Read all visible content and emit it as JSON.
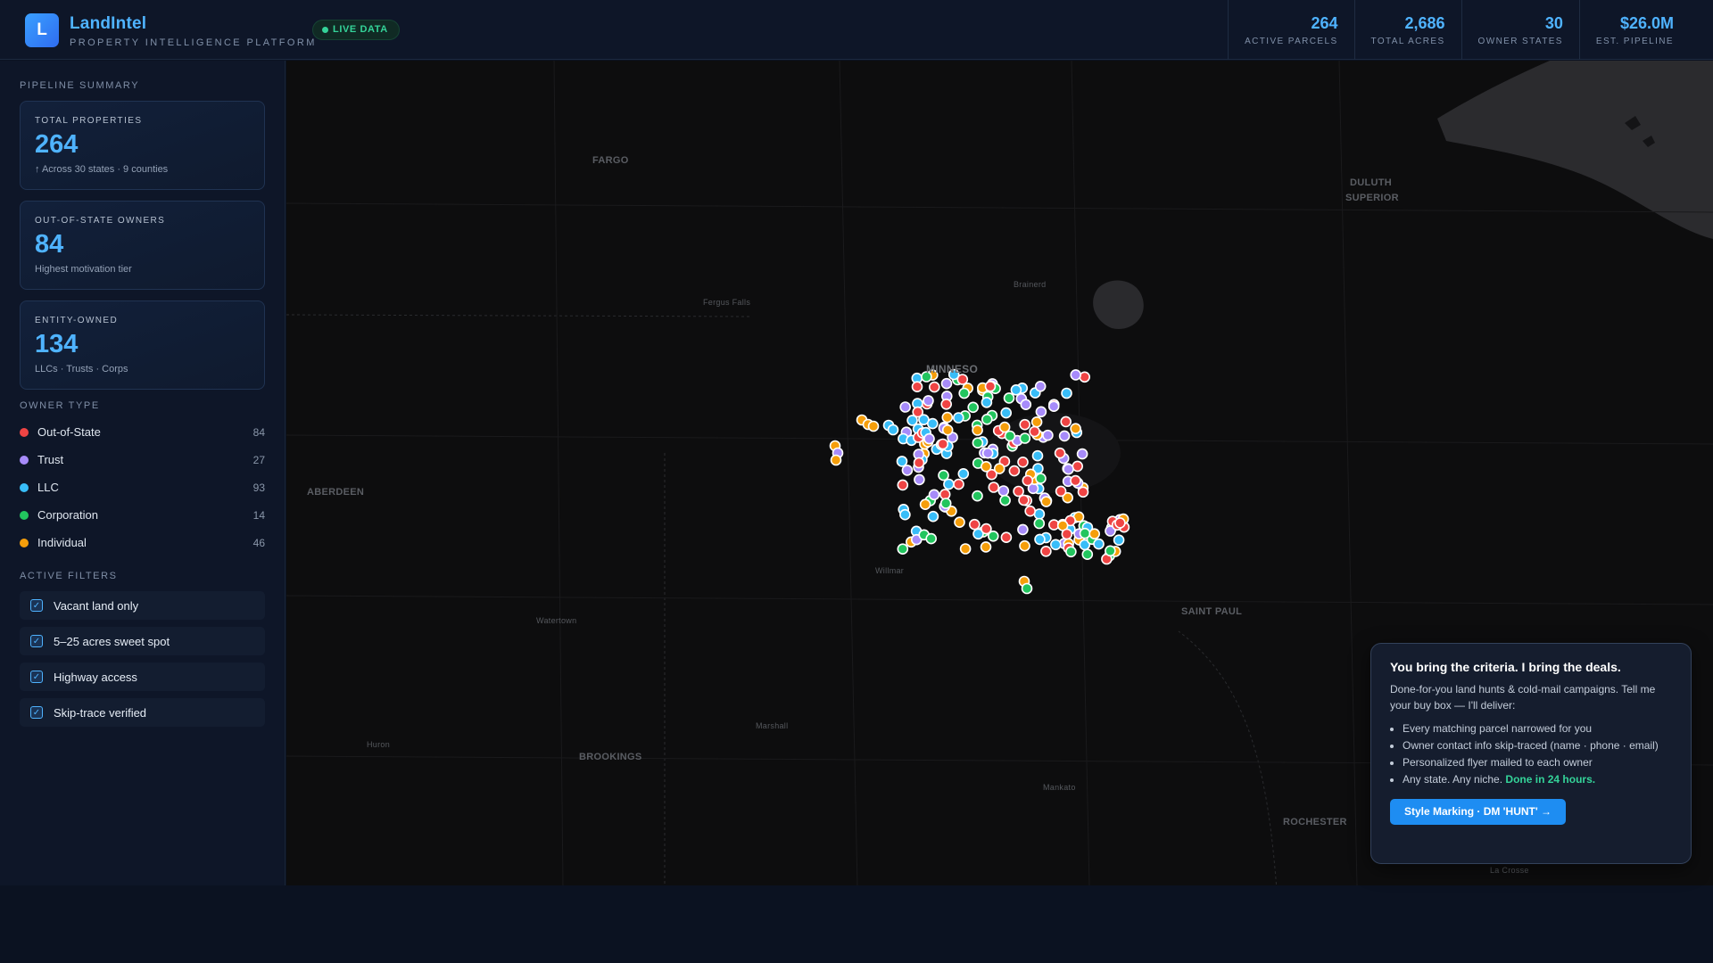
{
  "header": {
    "logo_letter": "L",
    "app_name": "LandIntel",
    "app_subtitle": "PROPERTY INTELLIGENCE PLATFORM",
    "live_badge": "LIVE DATA",
    "stats": [
      {
        "value": "264",
        "label": "ACTIVE PARCELS"
      },
      {
        "value": "2,686",
        "label": "TOTAL ACRES"
      },
      {
        "value": "30",
        "label": "OWNER STATES"
      },
      {
        "value": "$26.0M",
        "label": "EST. PIPELINE"
      }
    ]
  },
  "sidebar": {
    "pipeline_title": "PIPELINE SUMMARY",
    "cards": [
      {
        "label": "TOTAL PROPERTIES",
        "value": "264",
        "sub": "↑ Across 30 states · 9 counties"
      },
      {
        "label": "OUT-OF-STATE OWNERS",
        "value": "84",
        "sub": "Highest motivation tier"
      },
      {
        "label": "ENTITY-OWNED",
        "value": "134",
        "sub": "LLCs · Trusts · Corps"
      }
    ],
    "owner_type_title": "OWNER TYPE",
    "owner_types": [
      {
        "label": "Out-of-State",
        "count": "84",
        "color": "#ef4444"
      },
      {
        "label": "Trust",
        "count": "27",
        "color": "#a78bfa"
      },
      {
        "label": "LLC",
        "count": "93",
        "color": "#38bdf8"
      },
      {
        "label": "Corporation",
        "count": "14",
        "color": "#22c55e"
      },
      {
        "label": "Individual",
        "count": "46",
        "color": "#f59e0b"
      }
    ],
    "filters_title": "ACTIVE FILTERS",
    "filters": [
      {
        "label": "Vacant land only",
        "checked": true
      },
      {
        "label": "5–25 acres sweet spot",
        "checked": true
      },
      {
        "label": "Highway access",
        "checked": true
      },
      {
        "label": "Skip-trace verified",
        "checked": true
      }
    ]
  },
  "map": {
    "cities": [
      {
        "name": "FARGO",
        "size": "normal"
      },
      {
        "name": "DULUTH",
        "size": "normal"
      },
      {
        "name": "SUPERIOR",
        "size": "normal"
      },
      {
        "name": "Fergus Falls",
        "size": "small"
      },
      {
        "name": "Brainerd",
        "size": "small"
      },
      {
        "name": "MINNESO",
        "size": "big"
      },
      {
        "name": "ABERDEEN",
        "size": "normal"
      },
      {
        "name": "Willmar",
        "size": "small"
      },
      {
        "name": "Watertown",
        "size": "small"
      },
      {
        "name": "SAINT PAUL",
        "size": "normal"
      },
      {
        "name": "Marshall",
        "size": "small"
      },
      {
        "name": "Huron",
        "size": "small"
      },
      {
        "name": "BROOKINGS",
        "size": "normal"
      },
      {
        "name": "Mankato",
        "size": "small"
      },
      {
        "name": "ROCHESTER",
        "size": "normal"
      },
      {
        "name": "La Crosse",
        "size": "small"
      }
    ],
    "parcel_colors": [
      "#ef4444",
      "#a78bfa",
      "#38bdf8",
      "#22c55e",
      "#f59e0b"
    ]
  },
  "promo": {
    "title": "You bring the criteria. I bring the deals.",
    "body": "Done-for-you land hunts & cold-mail campaigns. Tell me your buy box — I'll deliver:",
    "items": [
      "Every matching parcel narrowed for you",
      "Owner contact info skip-traced (name · phone · email)",
      "Personalized flyer mailed to each owner"
    ],
    "last_item_prefix": "Any state. Any niche.",
    "last_item_highlight": "Done in 24 hours.",
    "cta": "Style Marking · DM 'HUNT' →"
  }
}
